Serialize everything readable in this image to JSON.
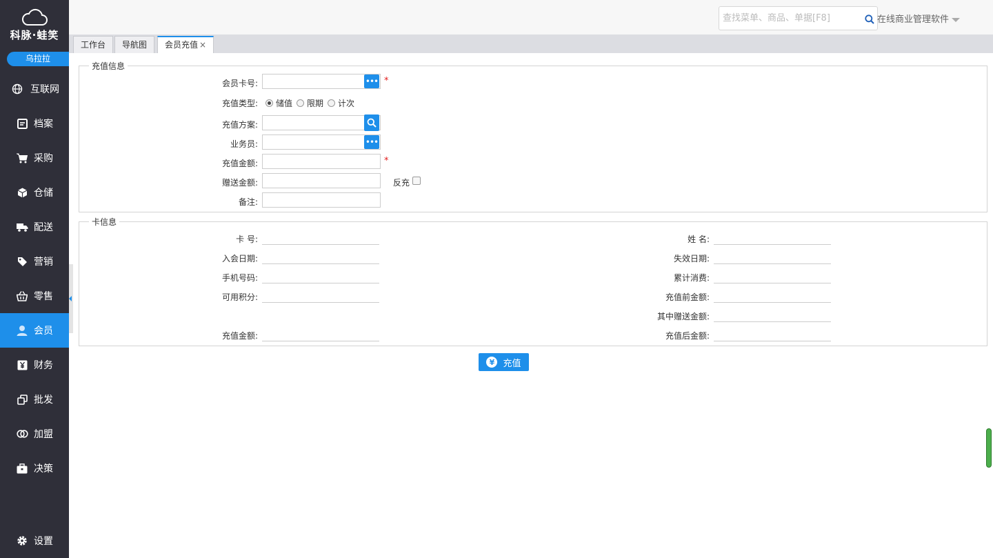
{
  "sidebar": {
    "brand": "科脉·蛙笑",
    "user": "乌拉拉",
    "items": [
      {
        "label": "互联网",
        "icon": "globe-icon"
      },
      {
        "label": "档案",
        "icon": "file-icon"
      },
      {
        "label": "采购",
        "icon": "cart-icon"
      },
      {
        "label": "仓储",
        "icon": "box-icon"
      },
      {
        "label": "配送",
        "icon": "truck-icon"
      },
      {
        "label": "营销",
        "icon": "tag-icon"
      },
      {
        "label": "零售",
        "icon": "basket-icon"
      },
      {
        "label": "会员",
        "icon": "person-icon"
      },
      {
        "label": "财务",
        "icon": "yen-icon"
      },
      {
        "label": "批发",
        "icon": "copy-icon"
      },
      {
        "label": "加盟",
        "icon": "rings-icon"
      },
      {
        "label": "决策",
        "icon": "briefcase-icon"
      }
    ],
    "active": "会员",
    "settings": "设置"
  },
  "header": {
    "search_placeholder": "查找菜单、商品、单据[F8]",
    "company": "在线商业管理软件"
  },
  "tabs": [
    {
      "label": "工作台"
    },
    {
      "label": "导航图"
    },
    {
      "label": "会员充值",
      "close": "×"
    }
  ],
  "recharge_info": {
    "legend": "充值信息",
    "card_no_label": "会员卡号:",
    "type_label": "充值类型:",
    "type_options": [
      "储值",
      "限期",
      "计次"
    ],
    "type_selected": "储值",
    "plan_label": "充值方案:",
    "salesman_label": "业务员:",
    "amount_label": "充值金额:",
    "gift_label": "赠送金额:",
    "reverse_label": "反充",
    "remark_label": "备注:",
    "required_mark": "*"
  },
  "card_info": {
    "legend": "卡信息",
    "card_no": "卡 号:",
    "join_date": "入会日期:",
    "phone": "手机号码:",
    "points": "可用积分:",
    "recharge_amount": "充值金额:",
    "name": "姓 名:",
    "expire_date": "失效日期:",
    "total_spend": "累计消费:",
    "before_amount": "充值前金额:",
    "gift_amount": "其中赠送金额:",
    "after_amount": "充值后金额:"
  },
  "actions": {
    "charge": "充值",
    "charge_icon": "yen-circle-icon"
  },
  "colors": {
    "accent": "#1e8fea",
    "sidebar": "#2f2f39",
    "required": "#e21c1c"
  }
}
